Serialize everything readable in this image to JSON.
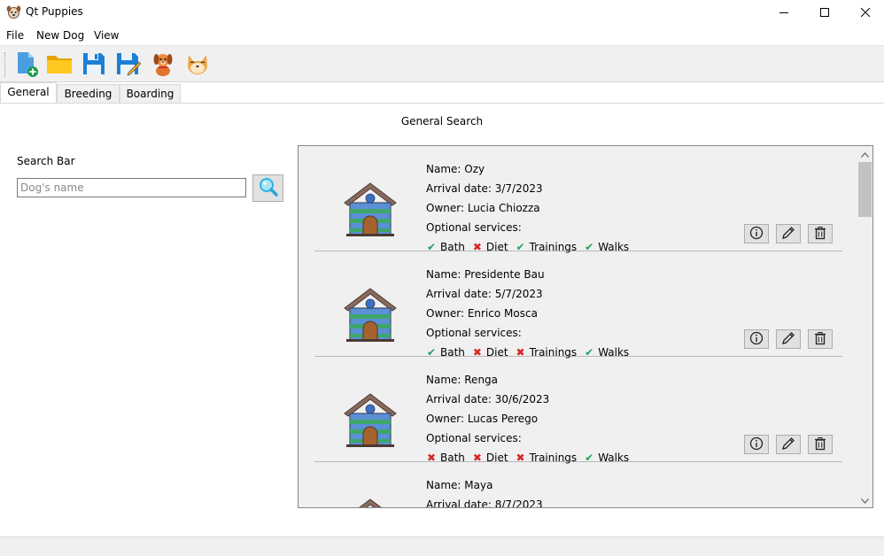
{
  "window": {
    "title": "Qt Puppies",
    "app_icon": "dog-face-icon",
    "controls": [
      "minimize-icon",
      "maximize-icon",
      "close-icon"
    ]
  },
  "menu": {
    "items": [
      {
        "label": "File"
      },
      {
        "label": "New Dog"
      },
      {
        "label": "View"
      }
    ]
  },
  "toolbar": {
    "buttons": [
      {
        "icon": "new-file-icon"
      },
      {
        "icon": "open-folder-icon"
      },
      {
        "icon": "save-icon"
      },
      {
        "icon": "save-as-icon"
      },
      {
        "icon": "dog-icon"
      },
      {
        "icon": "shiba-dog-icon"
      }
    ]
  },
  "tabs": [
    {
      "label": "General",
      "active": true
    },
    {
      "label": "Breeding",
      "active": false
    },
    {
      "label": "Boarding",
      "active": false
    }
  ],
  "general": {
    "section_title": "General Search",
    "search_label": "Search Bar",
    "search_placeholder": "Dog's name",
    "search_value": ""
  },
  "dogs": [
    {
      "name": "Name: Ozy",
      "arrival": "Arrival date: 3/7/2023",
      "owner": "Owner: Lucia Chiozza",
      "services_label": "Optional services:",
      "services": [
        {
          "label": "Bath",
          "enabled": true
        },
        {
          "label": "Diet",
          "enabled": false
        },
        {
          "label": "Trainings",
          "enabled": true
        },
        {
          "label": "Walks",
          "enabled": true
        }
      ]
    },
    {
      "name": "Name: Presidente Bau",
      "arrival": "Arrival date: 5/7/2023",
      "owner": "Owner: Enrico Mosca",
      "services_label": "Optional services:",
      "services": [
        {
          "label": "Bath",
          "enabled": true
        },
        {
          "label": "Diet",
          "enabled": false
        },
        {
          "label": "Trainings",
          "enabled": false
        },
        {
          "label": "Walks",
          "enabled": true
        }
      ]
    },
    {
      "name": "Name: Renga",
      "arrival": "Arrival date: 30/6/2023",
      "owner": "Owner: Lucas Perego",
      "services_label": "Optional services:",
      "services": [
        {
          "label": "Bath",
          "enabled": false
        },
        {
          "label": "Diet",
          "enabled": false
        },
        {
          "label": "Trainings",
          "enabled": false
        },
        {
          "label": "Walks",
          "enabled": true
        }
      ]
    },
    {
      "name": "Name: Maya",
      "arrival": "Arrival date: 8/7/2023",
      "owner": "",
      "services_label": "",
      "services": []
    }
  ],
  "colors": {
    "check": "#1fa35a",
    "cross": "#d42828",
    "house_roof": "#8a6a5c",
    "house_stripe_blue": "#5b8fd6",
    "house_stripe_green": "#3fa56a"
  }
}
